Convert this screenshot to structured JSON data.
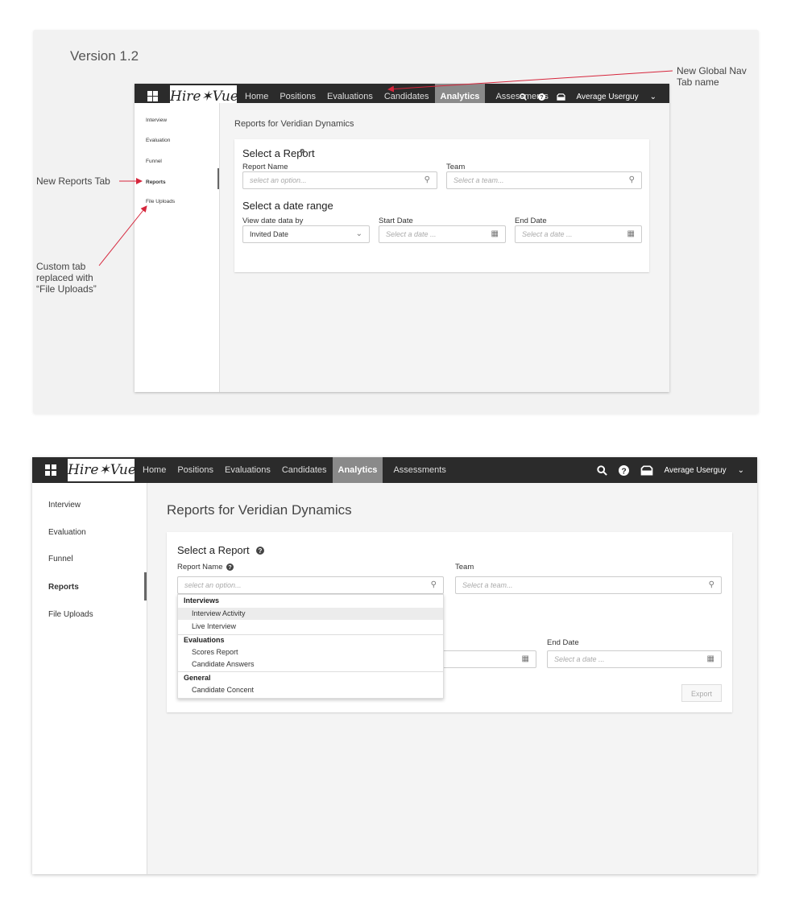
{
  "annotations": {
    "version": "Version 1.2",
    "global_nav_note": "New Global Nav\nTab name",
    "reports_tab_note": "New Reports Tab",
    "custom_tab_note": "Custom tab\nreplaced with\n“File Uploads”"
  },
  "app": {
    "brand": "Hire✶Vue",
    "nav_tabs": [
      "Home",
      "Positions",
      "Evaluations",
      "Candidates",
      "Analytics",
      "Assessments"
    ],
    "active_tab": "Analytics",
    "user": "Average Userguy",
    "sidebar": [
      "Interview",
      "Evaluation",
      "Funnel",
      "Reports",
      "File Uploads"
    ],
    "active_sidebar": "Reports",
    "page_title": "Reports for Veridian Dynamics",
    "report_section_title": "Select a Report",
    "report_name_label": "Report Name",
    "report_name_placeholder": "select an option...",
    "team_label": "Team",
    "team_placeholder": "Select a team...",
    "date_section_title": "Select a date range",
    "view_by_label": "View date data by",
    "view_by_value": "Invited Date",
    "start_date_label": "Start Date",
    "end_date_label": "End Date",
    "date_placeholder": "Select a date ...",
    "export_label": "Export"
  },
  "dropdown": {
    "groups": [
      {
        "name": "Interviews",
        "options": [
          "Interview Activity",
          "Live Interview"
        ]
      },
      {
        "name": "Evaluations",
        "options": [
          "Scores Report",
          "Candidate Answers"
        ]
      },
      {
        "name": "General",
        "options": [
          "Candidate Concent"
        ]
      }
    ],
    "highlighted": "Interview Activity"
  }
}
